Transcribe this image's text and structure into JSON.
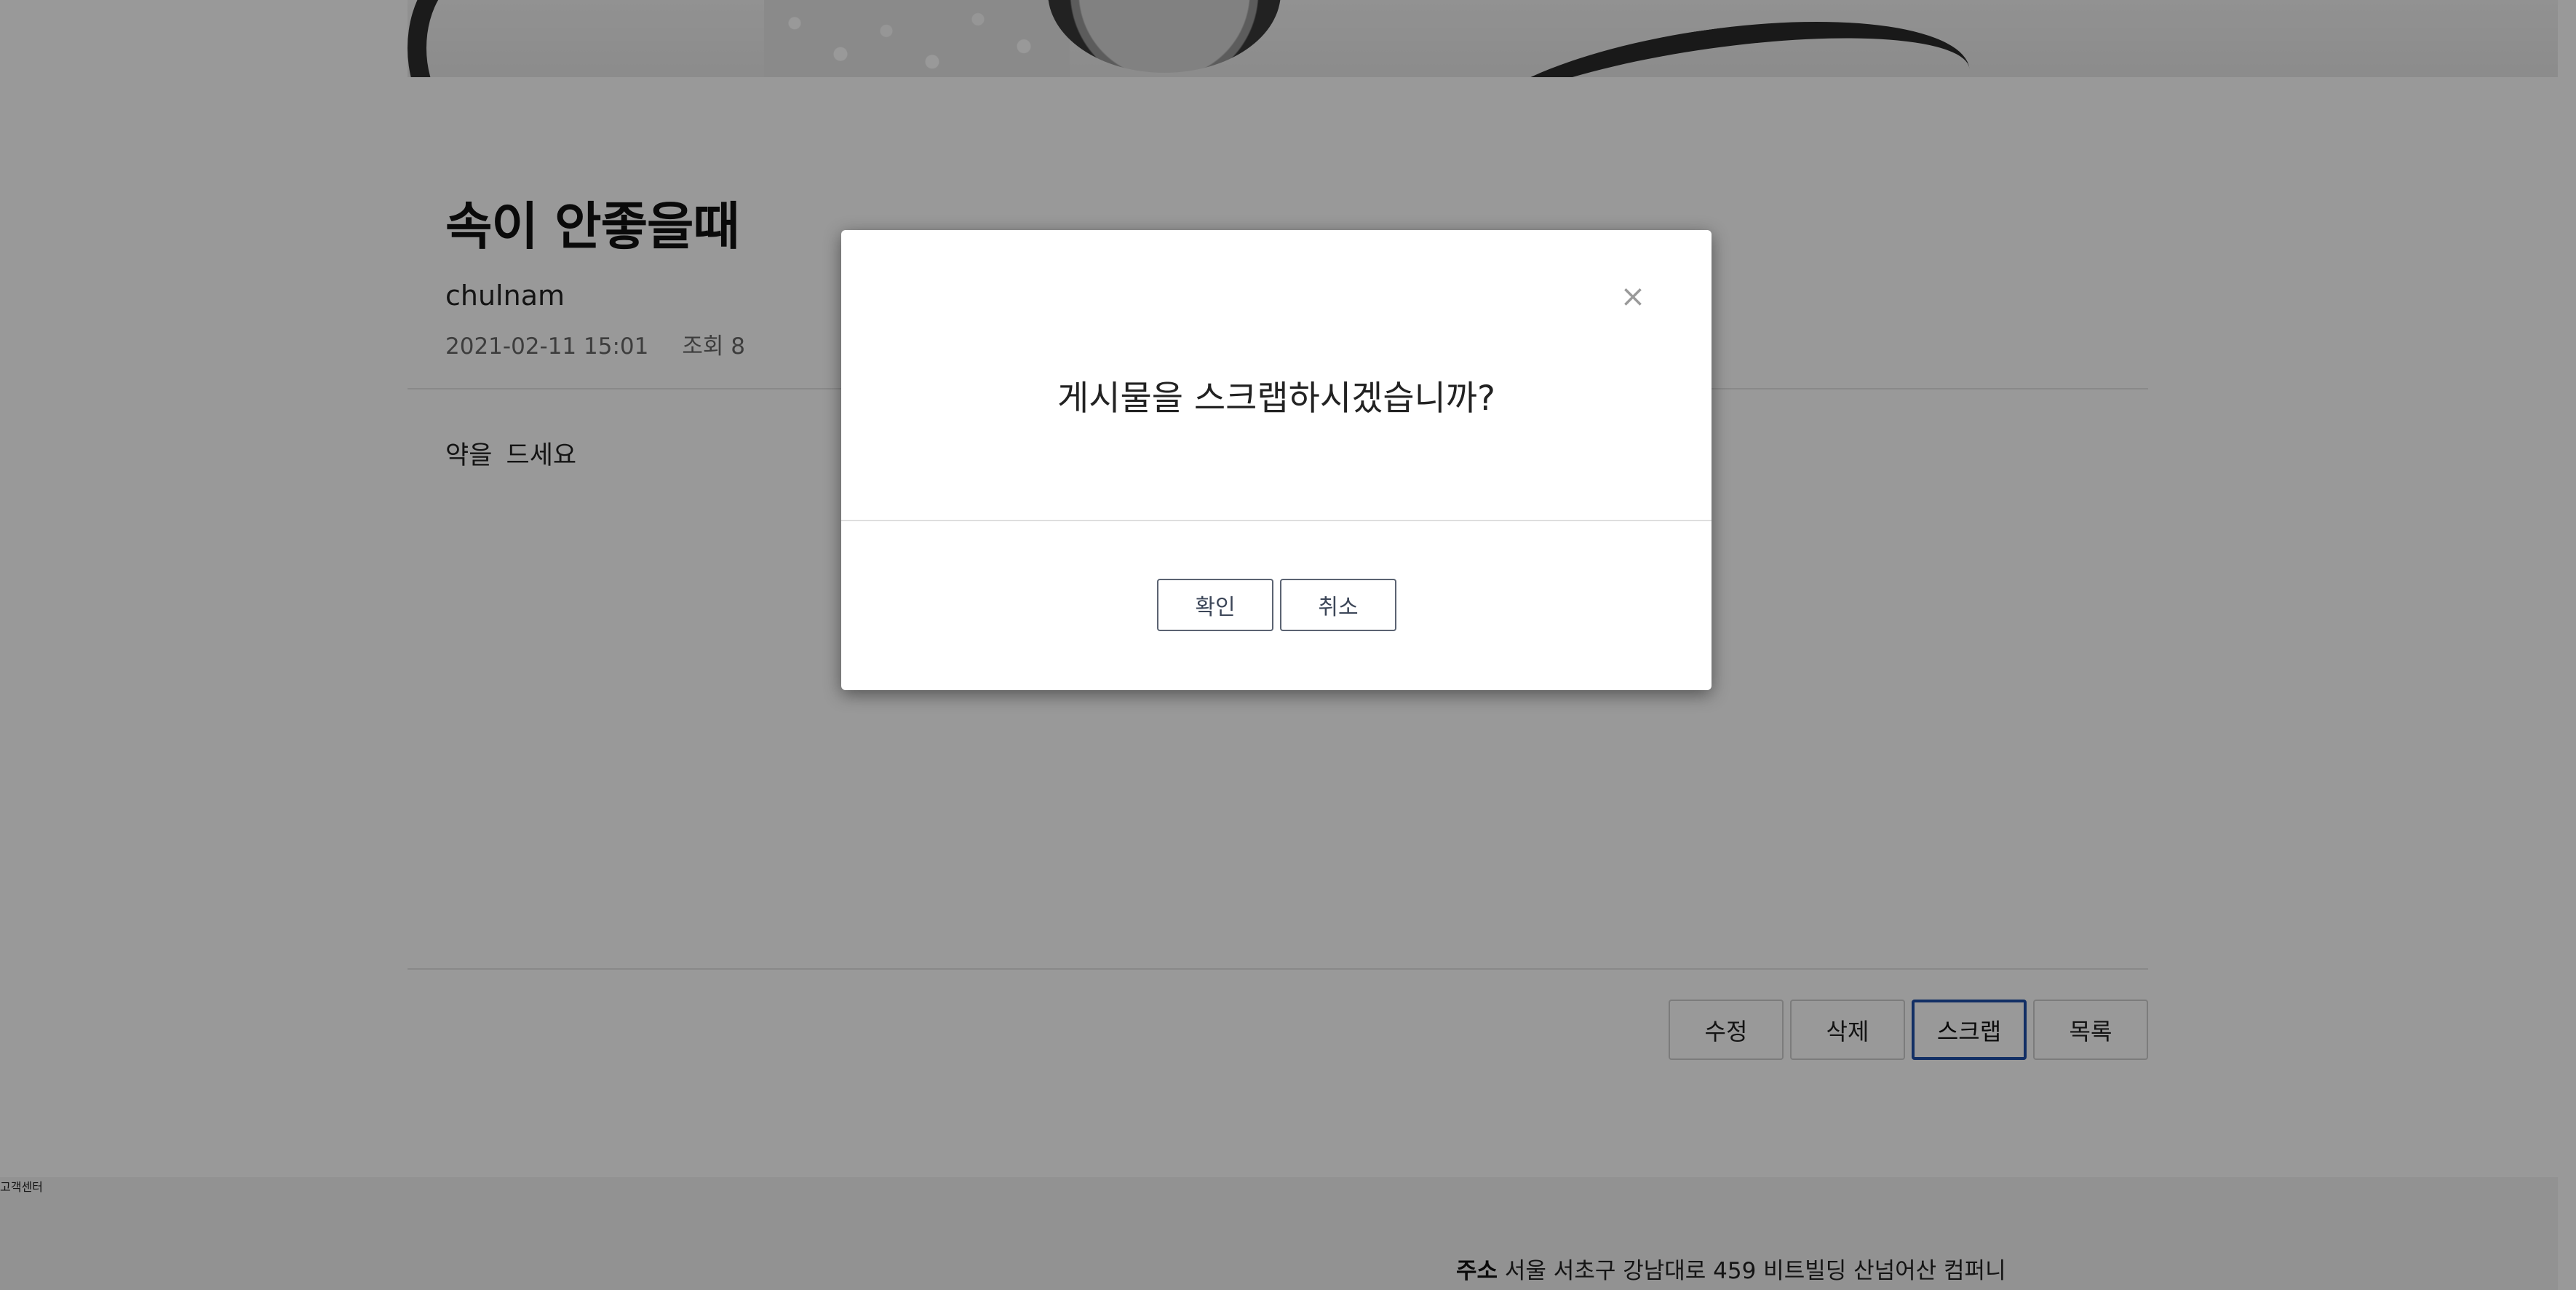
{
  "post": {
    "title": "속이 안좋을때",
    "author": "chulnam",
    "date": "2021-02-11 15:01",
    "views": "조회 8",
    "body": "약을  드세요"
  },
  "actions": {
    "edit": "수정",
    "delete": "삭제",
    "scrap": "스크랩",
    "list": "목록"
  },
  "footer": {
    "customer_center": "고객센터",
    "address_label": "주소",
    "address_text": "서울 서초구 강남대로 459 비트빌딩 산넘어산 컴퍼니"
  },
  "modal": {
    "close_symbol": "×",
    "message": "게시물을 스크랩하시겠습니까?",
    "confirm": "확인",
    "cancel": "취소"
  }
}
